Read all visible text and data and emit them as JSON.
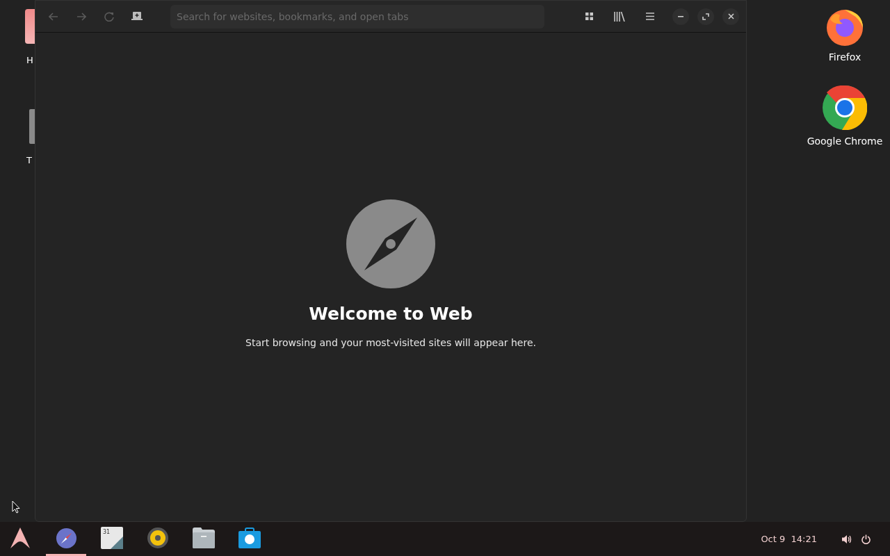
{
  "desktop_icons_left": [
    {
      "kind": "pink",
      "label": "H"
    },
    {
      "kind": "grey",
      "label": "T"
    }
  ],
  "desktop_icons_right": [
    {
      "kind": "firefox",
      "label": "Firefox"
    },
    {
      "kind": "chrome",
      "label": "Google Chrome"
    }
  ],
  "browser": {
    "toolbar": {
      "back": {
        "disabled": true
      },
      "forward": {
        "disabled": true
      },
      "reload": {
        "disabled": true
      },
      "search": {
        "placeholder": "Search for websites, bookmarks, and open tabs"
      }
    },
    "welcome": {
      "title": "Welcome to Web",
      "subtitle": "Start browsing and your most-visited sites will appear here."
    }
  },
  "taskbar": {
    "items": [
      {
        "kind": "launcher",
        "selected": false
      },
      {
        "kind": "browser",
        "selected": true
      },
      {
        "kind": "calendar",
        "selected": false,
        "text": "31"
      },
      {
        "kind": "music",
        "selected": false
      },
      {
        "kind": "files",
        "selected": false
      },
      {
        "kind": "store",
        "selected": false
      }
    ],
    "clock": "Oct 9  14:21"
  }
}
